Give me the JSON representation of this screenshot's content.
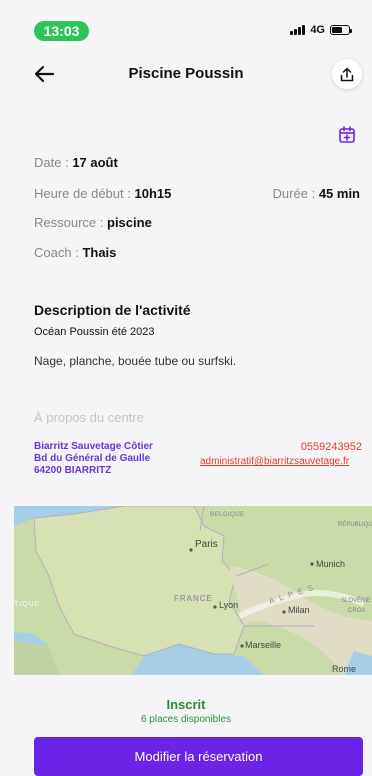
{
  "status_bar": {
    "time": "13:03",
    "network": "4G"
  },
  "header": {
    "title": "Piscine Poussin"
  },
  "details": {
    "date_label": "Date :",
    "date_value": "17 août",
    "start_label": "Heure de début :",
    "start_value": "10h15",
    "duration_label": "Durée :",
    "duration_value": "45 min",
    "resource_label": "Ressource :",
    "resource_value": "piscine",
    "coach_label": "Coach :",
    "coach_value": "Thais"
  },
  "description": {
    "title": "Description de l'activité",
    "subtitle": "Océan Poussin été 2023",
    "body": "Nage, planche, bouée tube ou surfski."
  },
  "center": {
    "title": "À propos du centre",
    "name": "Biarritz Sauvetage Côtier",
    "street": "Bd du Général de Gaulle",
    "city": "64200 BIARRITZ",
    "phone": "0559243952",
    "email": "administratif@biarritzsauvetage.fr"
  },
  "map": {
    "labels": [
      "BELGIQUE",
      "Paris",
      "RÉPUBLIQUE TCHÈQUE",
      "Munich",
      "FRANCE",
      "Lyon",
      "ALPES",
      "Milan",
      "SLOVÉNIE",
      "CROA",
      "Marseille",
      "Rome",
      "TIQUE"
    ]
  },
  "booking": {
    "status": "Inscrit",
    "places": "6 places disponibles",
    "button": "Modifier la réservation"
  },
  "colors": {
    "accent": "#6b23e8",
    "success": "#2e8b3a",
    "link": "#e33b2b",
    "time_pill": "#2ec45a"
  }
}
